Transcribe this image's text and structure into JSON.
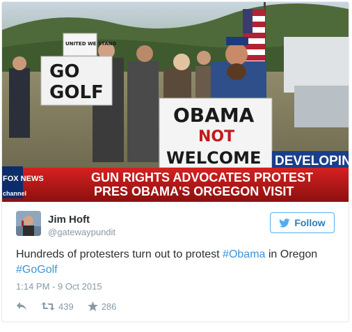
{
  "media": {
    "sign_go_golf": "GO GOLF",
    "sign_go_golf_line1": "GO",
    "sign_go_golf_line2": "GOLF",
    "sign_united": "UNITED WE STAND",
    "sign_obama_line1": "OBAMA",
    "sign_obama_line2": "NOT",
    "sign_obama_line3": "WELCOME",
    "network_logo": "FOX NEWS",
    "network_logo_sub": "channel",
    "banner_tag": "DEVELOPING",
    "headline_line1": "GUN RIGHTS ADVOCATES PROTEST",
    "headline_line2": "PRES OBAMA'S ORGEGON VISIT"
  },
  "author": {
    "name": "Jim Hoft",
    "handle": "@gatewaypundit"
  },
  "follow_button": {
    "label": "Follow",
    "icon": "twitter-bird-icon"
  },
  "tweet": {
    "text_before": "Hundreds of protesters turn out to protest ",
    "hashtag_1": "#Obama",
    "text_middle": " in Oregon",
    "hashtag_2": "#GoGolf",
    "timestamp": "1:14 PM - 9 Oct 2015"
  },
  "actions": {
    "reply_icon": "reply-icon",
    "retweet_icon": "retweet-icon",
    "retweet_count": "439",
    "like_icon": "star-icon",
    "like_count": "286"
  },
  "colors": {
    "accent": "#55acee",
    "link": "#3b94d9",
    "text": "#292f33",
    "muted": "#8899a6",
    "chyron_red": "#c01b1b"
  }
}
